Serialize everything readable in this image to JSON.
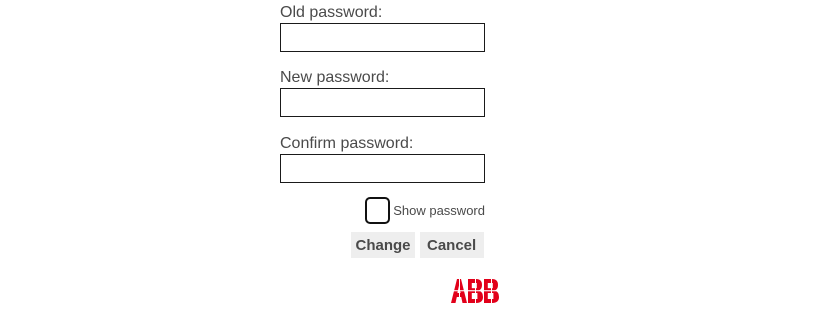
{
  "form": {
    "old_password": {
      "label": "Old password:",
      "value": ""
    },
    "new_password": {
      "label": "New password:",
      "value": ""
    },
    "confirm_password": {
      "label": "Confirm password:",
      "value": ""
    },
    "show_password": {
      "label": "Show password",
      "checked": false
    },
    "buttons": {
      "change": "Change",
      "cancel": "Cancel"
    }
  },
  "logo": {
    "text": "ABB",
    "color": "#e2001a"
  },
  "colors": {
    "text": "#4a4a4a",
    "input_border": "#1a1a1a",
    "button_bg": "#eeeeee"
  }
}
